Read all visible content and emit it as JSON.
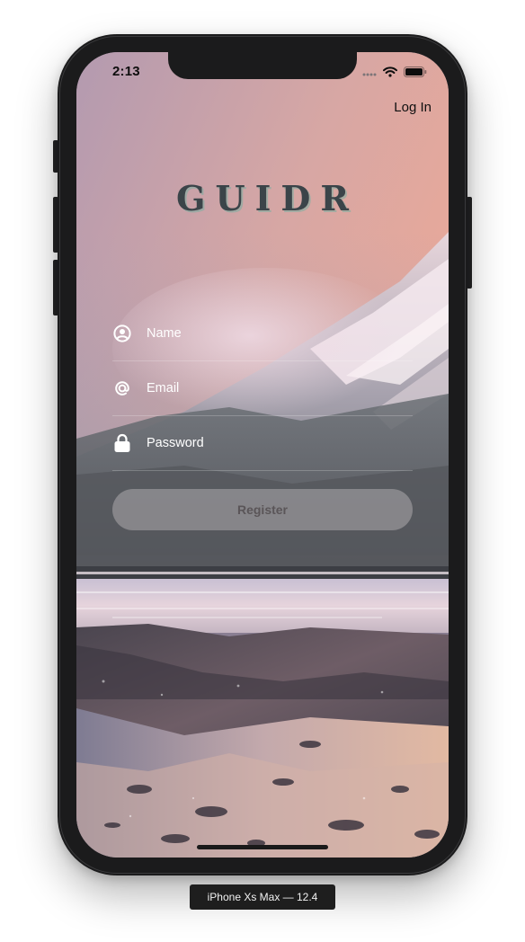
{
  "status_bar": {
    "time": "2:13"
  },
  "header": {
    "login_label": "Log In"
  },
  "app": {
    "logo": "GUIDR"
  },
  "form": {
    "name_placeholder": "Name",
    "email_placeholder": "Email",
    "password_placeholder": "Password",
    "register_label": "Register"
  },
  "simulator": {
    "device_label": "iPhone Xs Max — 12.4"
  },
  "icons": {
    "name": "user-circle-icon",
    "email": "at-sign-icon",
    "password": "lock-icon",
    "signal": "cellular-signal-icon",
    "wifi": "wifi-icon",
    "battery": "battery-icon"
  },
  "colors": {
    "frame": "#1b1b1c",
    "logo": "#3b4449",
    "button_bg": "#c8c4c6",
    "text_light": "#ffffff"
  }
}
